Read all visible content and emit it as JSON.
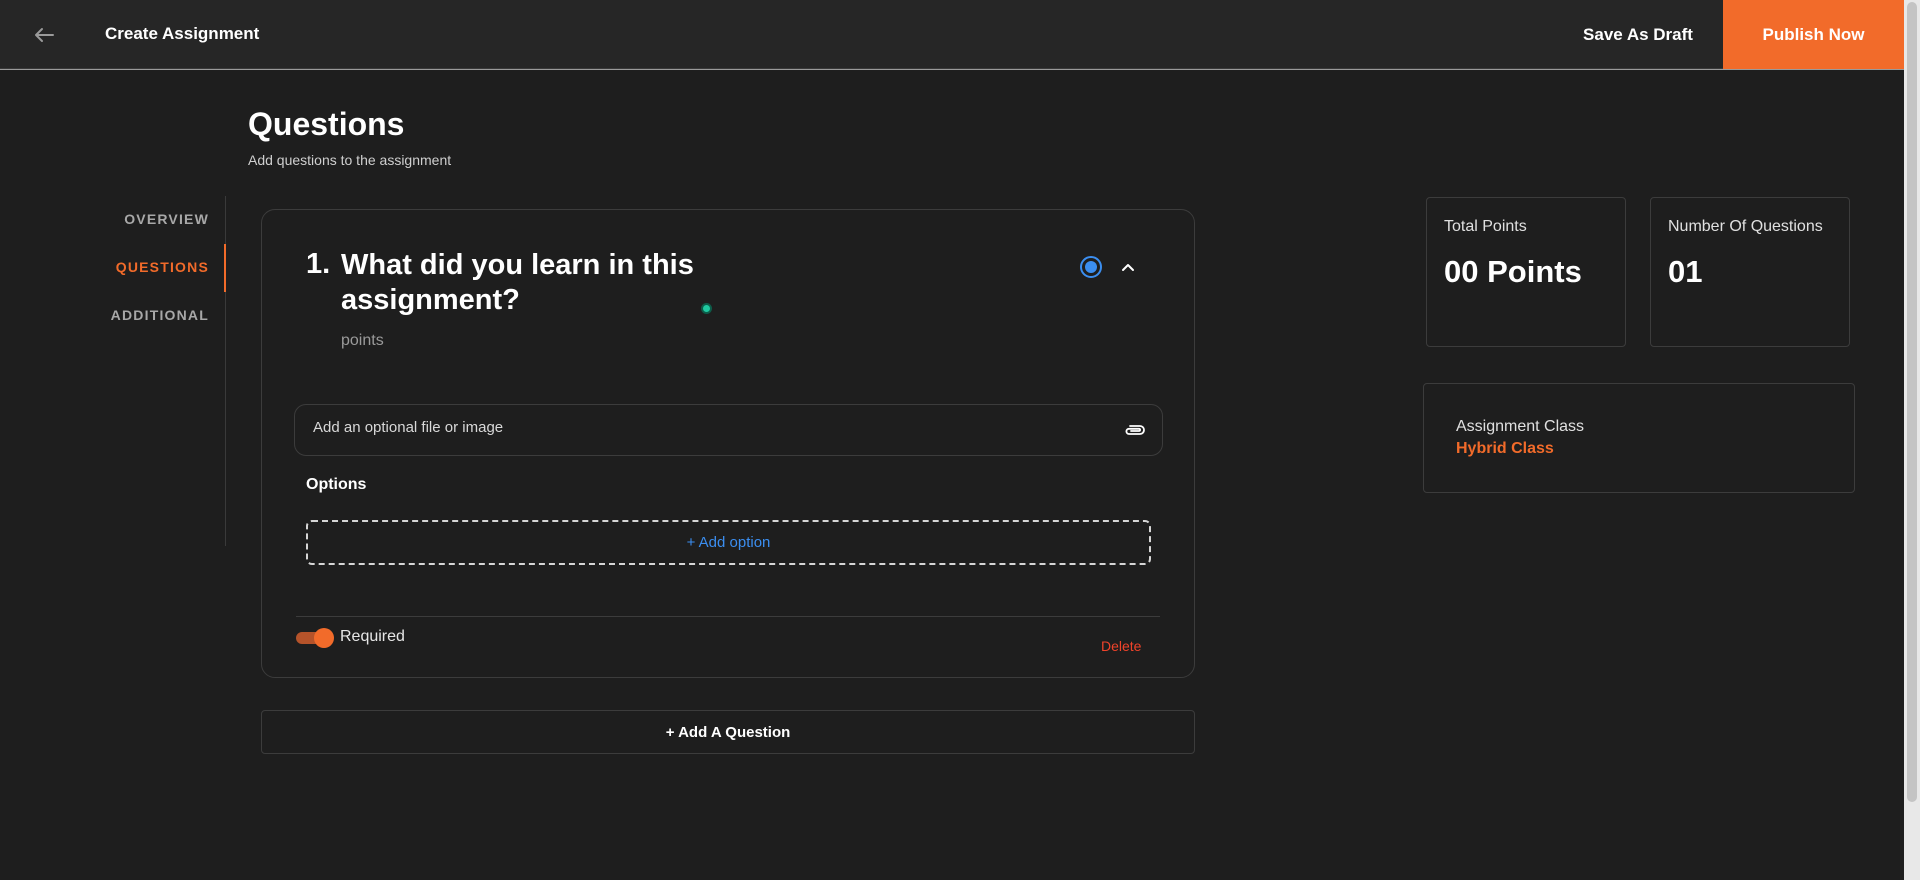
{
  "header": {
    "title": "Create Assignment",
    "save_draft_label": "Save As Draft",
    "publish_label": "Publish Now"
  },
  "page": {
    "title": "Questions",
    "subtitle": "Add questions to the assignment"
  },
  "sidenav": {
    "items": [
      {
        "label": "OVERVIEW",
        "active": false
      },
      {
        "label": "QUESTIONS",
        "active": true
      },
      {
        "label": "ADDITIONAL",
        "active": false
      }
    ]
  },
  "question": {
    "number": "1.",
    "title": "What did you learn in this assignment?",
    "points_label": "points",
    "attachment_placeholder": "Add an optional file or image",
    "options_label": "Options",
    "add_option_label": "+ Add option",
    "required_label": "Required",
    "required": true,
    "delete_label": "Delete"
  },
  "add_question_label": "+ Add A Question",
  "stats": {
    "total_points_label": "Total Points",
    "total_points_value": "00 Points",
    "num_questions_label": "Number Of Questions",
    "num_questions_value": "01"
  },
  "assignment_class": {
    "label": "Assignment Class",
    "value": "Hybrid Class"
  },
  "colors": {
    "accent": "#f26b2a",
    "link": "#3b8ef0",
    "danger": "#f0432a",
    "background": "#1e1e1e"
  },
  "icons": {
    "back": "arrow-left-icon",
    "question_type": "radio-icon",
    "collapse": "chevron-up-icon",
    "attach": "paperclip-icon"
  }
}
